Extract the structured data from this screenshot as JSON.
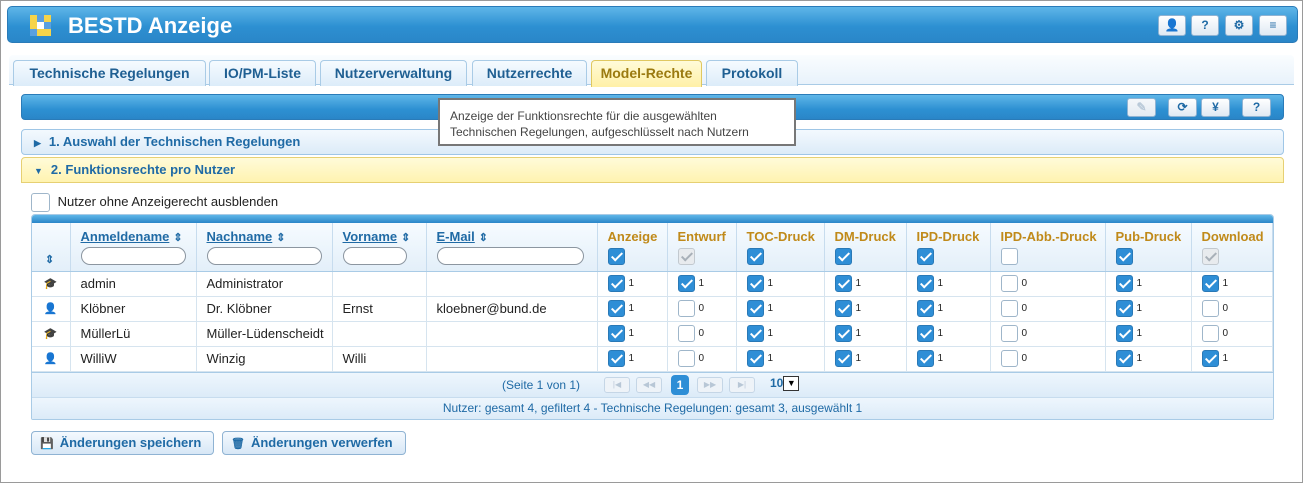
{
  "app": {
    "title": "BESTD Anzeige"
  },
  "header_buttons": [
    {
      "name": "user-icon",
      "glyph": "👤"
    },
    {
      "name": "help-icon",
      "glyph": "?"
    },
    {
      "name": "gear-icon",
      "glyph": "⚙"
    },
    {
      "name": "menu-icon",
      "glyph": "≡"
    }
  ],
  "tabs": [
    {
      "label": "Technische Regelungen"
    },
    {
      "label": "IO/PM-Liste"
    },
    {
      "label": "Nutzerverwaltung"
    },
    {
      "label": "Nutzerrechte"
    },
    {
      "label": "Model-Rechte",
      "active": true
    },
    {
      "label": "Protokoll"
    }
  ],
  "toolbar_buttons": [
    {
      "name": "edit-icon",
      "glyph": "✎",
      "disabled": true
    },
    {
      "name": "refresh-icon",
      "glyph": "⟳"
    },
    {
      "name": "currency-icon",
      "glyph": "¥"
    },
    {
      "name": "help-icon",
      "glyph": "?"
    }
  ],
  "tooltip": "Anzeige der Funktionsrechte für die ausgewählten Technischen Regelungen, aufgeschlüsselt nach Nutzern",
  "sections": {
    "selection": "1. Auswahl der Technischen Regelungen",
    "rights": "2. Funktionsrechte pro Nutzer"
  },
  "filter_label": "Nutzer ohne Anzeigerecht ausblenden",
  "columns": {
    "login": "Anmeldename",
    "lastname": "Nachname",
    "firstname": "Vorname",
    "email": "E-Mail",
    "anzeige": "Anzeige",
    "entwurf": "Entwurf",
    "toc": "TOC-Druck",
    "dm": "DM-Druck",
    "ipd": "IPD-Druck",
    "ipdabb": "IPD-Abb.-Druck",
    "pub": "Pub-Druck",
    "download": "Download"
  },
  "header_checks": [
    "checked",
    "grey",
    "checked",
    "checked",
    "checked",
    "empty",
    "checked",
    "grey"
  ],
  "rows": [
    {
      "icon": "graduation-cap-icon",
      "glyph": "🎓",
      "login": "admin",
      "lastname": "Administrator",
      "firstname": "",
      "email": "",
      "rights": [
        1,
        1,
        1,
        1,
        1,
        0,
        1,
        1
      ]
    },
    {
      "icon": "user-icon",
      "glyph": "👤",
      "login": "Klöbner",
      "lastname": "Dr. Klöbner",
      "firstname": "Ernst",
      "email": "kloebner@bund.de",
      "rights": [
        1,
        0,
        1,
        1,
        1,
        0,
        1,
        0
      ]
    },
    {
      "icon": "graduation-cap-icon",
      "glyph": "🎓",
      "login": "MüllerLü",
      "lastname": "Müller-Lüdenscheidt",
      "firstname": "",
      "email": "",
      "rights": [
        1,
        0,
        1,
        1,
        1,
        0,
        1,
        0
      ]
    },
    {
      "icon": "user-icon",
      "glyph": "👤",
      "login": "WilliW",
      "lastname": "Winzig",
      "firstname": "Willi",
      "email": "",
      "rights": [
        1,
        0,
        1,
        1,
        1,
        0,
        1,
        1
      ]
    }
  ],
  "pager": {
    "info": "(Seite 1 von 1)",
    "current": "1",
    "page_size": "10"
  },
  "summary": "Nutzer: gesamt 4, gefiltert 4 - Technische Regelungen: gesamt 3, ausgewählt 1",
  "actions": {
    "save": "Änderungen speichern",
    "discard": "Änderungen verwerfen"
  },
  "colors": {
    "accent": "#2e8ed6",
    "header": "#2d90d2",
    "active_tab": "#fff0a6",
    "perm_header": "#c08a1a"
  }
}
